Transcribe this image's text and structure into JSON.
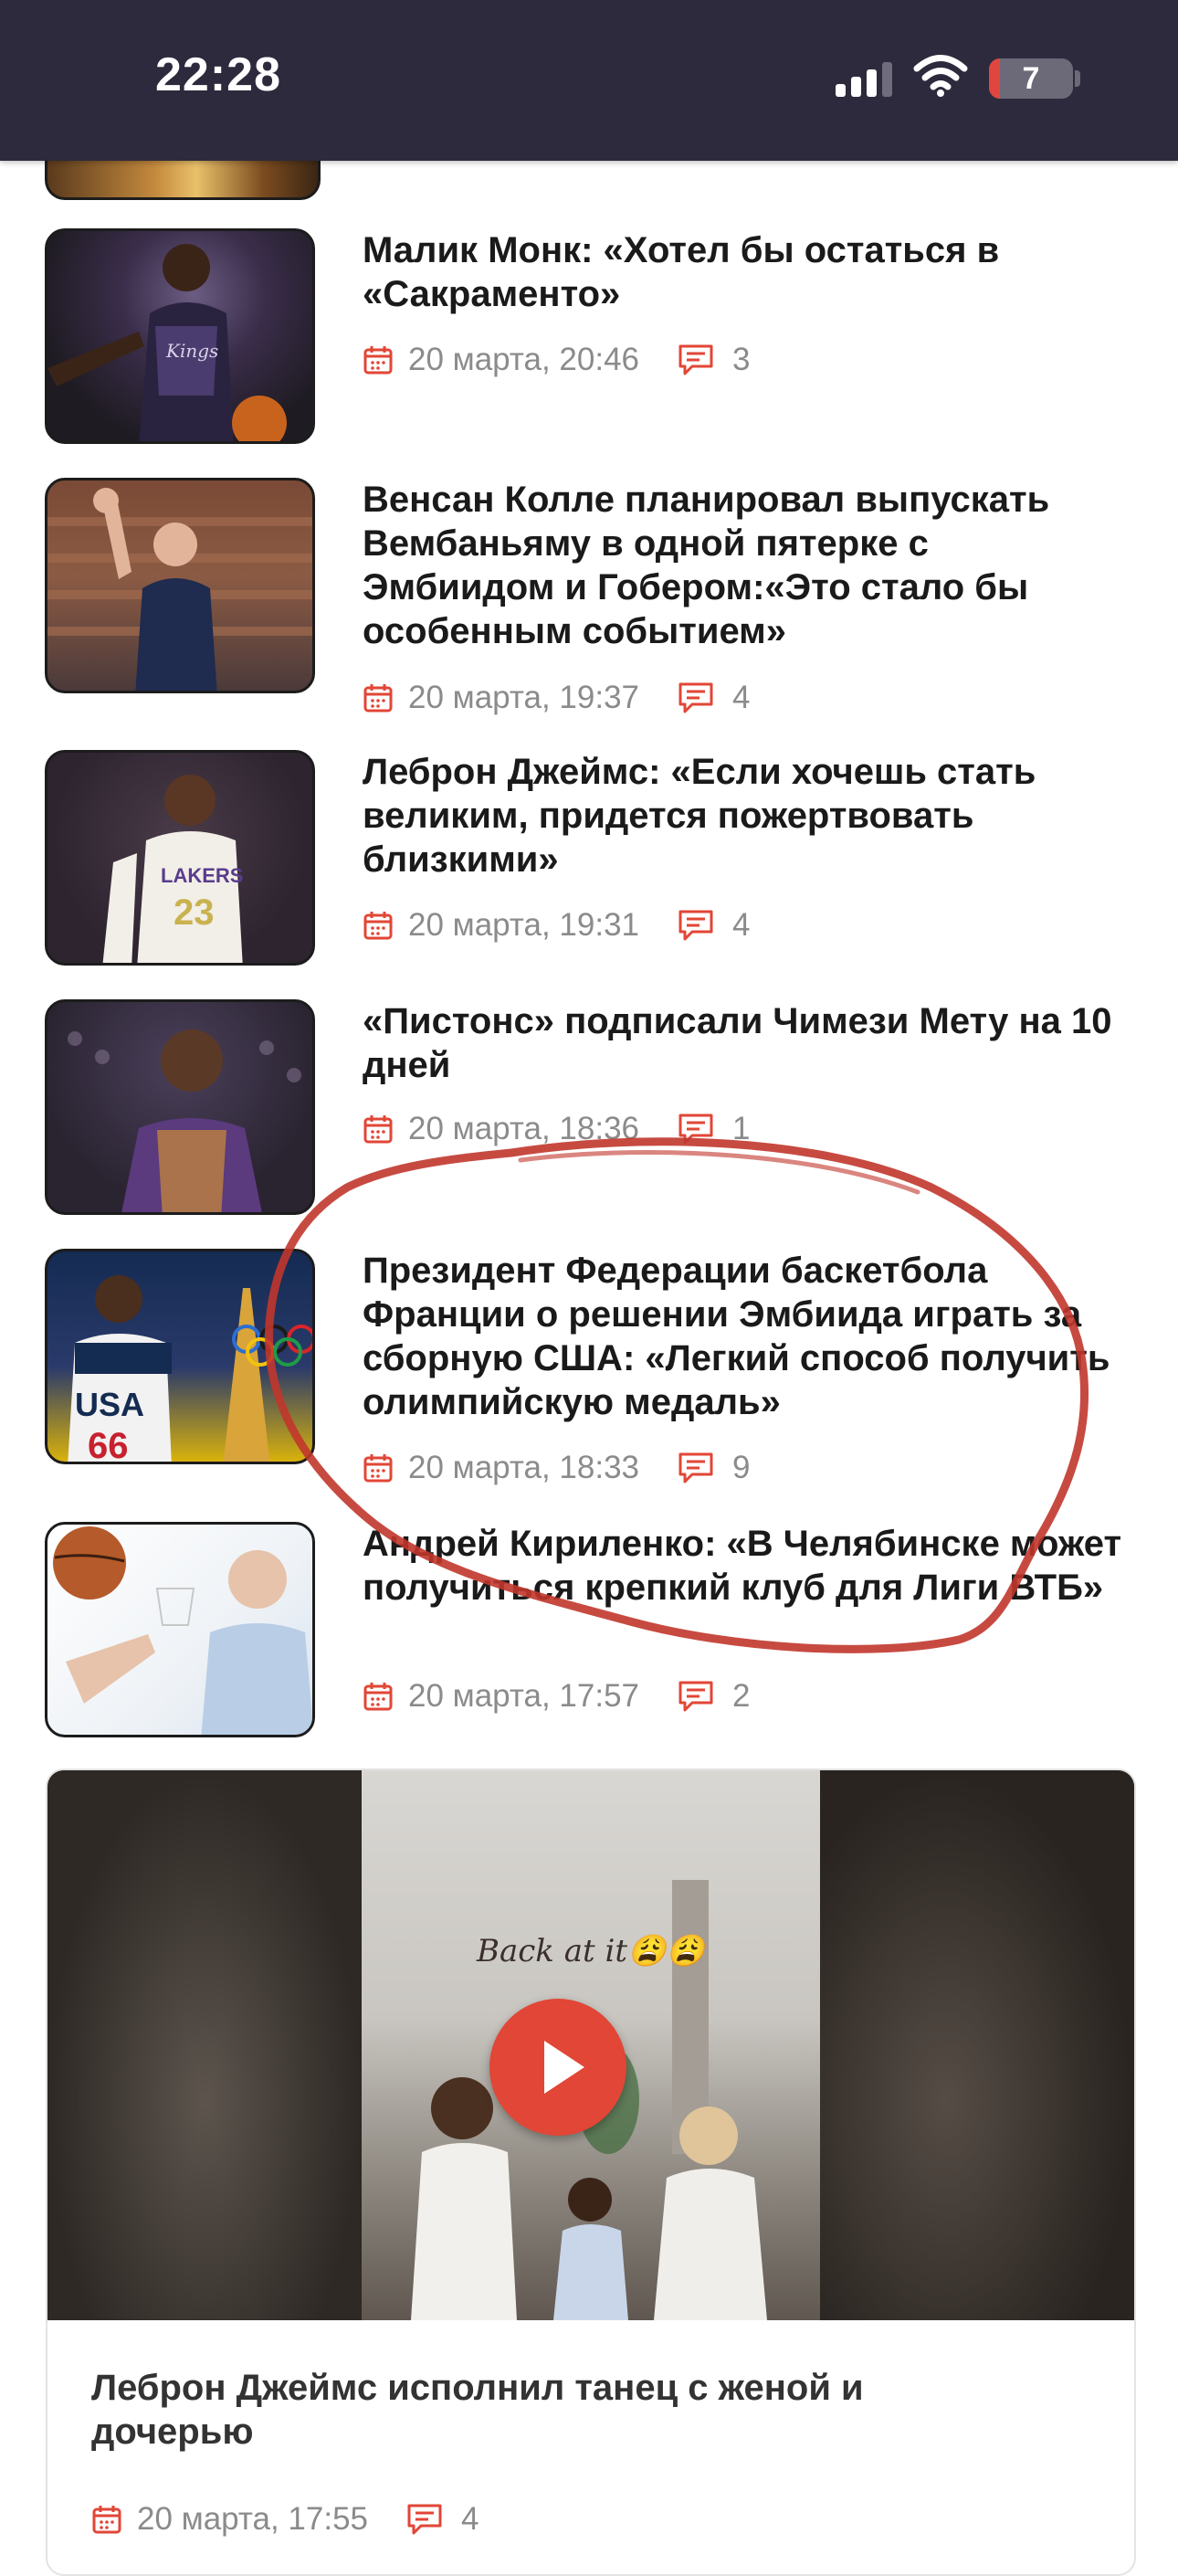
{
  "status_bar": {
    "time": "22:28",
    "battery": "7"
  },
  "articles": [
    {
      "title": "Малик Монк: «Хотел бы остаться в «Сакраменто»",
      "date": "20 марта, 20:46",
      "comments": "3",
      "thumb_colors": [
        "#1e1b22",
        "#3a2d4a",
        "#6b5c82"
      ]
    },
    {
      "title": "Венсан Колле планировал выпускать Вембаньяму в одной пятерке с Эмбиидом и Гобером:«Это стало бы особенным событием»",
      "date": "20 марта, 19:37",
      "comments": "4",
      "thumb_colors": [
        "#5a3a2c",
        "#8c5b44",
        "#2a3552"
      ]
    },
    {
      "title": "Леброн Джеймс: «Если хочешь стать великим, придется пожертвовать близкими»",
      "date": "20 марта, 19:31",
      "comments": "4",
      "thumb_colors": [
        "#2d2430",
        "#c9b24f",
        "#f2efe8"
      ]
    },
    {
      "title": "«Пистонс» подписали Чимези Мету на 10 дней",
      "date": "20 марта, 18:36",
      "comments": "1",
      "thumb_colors": [
        "#3b3140",
        "#5b3a7e",
        "#8a5d3e"
      ]
    },
    {
      "title": "Президент Федерации баскетбола Франции о решении Эмбиида играть за сборную США: «Легкий способ получить олимпийскую медаль»",
      "date": "20 марта, 18:33",
      "comments": "9",
      "thumb_colors": [
        "#142b52",
        "#c8202e",
        "#f3c20f"
      ]
    },
    {
      "title": "Андрей Кириленко: «В Челябинске может получиться крепкий клуб для Лиги ВТБ»",
      "date": "20 марта, 17:57",
      "comments": "2",
      "thumb_colors": [
        "#ffffff",
        "#d8e3ef",
        "#b55a2a"
      ]
    }
  ],
  "video_item": {
    "title": "Леброн Джеймс исполнил танец с женой и дочерью",
    "date": "20 марта, 17:55",
    "comments": "4",
    "caption": "Back at it😩😩"
  },
  "colors": {
    "accent": "#e24636",
    "status_bar": "#2c2a3c",
    "annotation": "#c1362c"
  },
  "icons": {
    "date": "calendar-icon",
    "comments": "comment-bubble-icon",
    "video": "play-icon"
  }
}
